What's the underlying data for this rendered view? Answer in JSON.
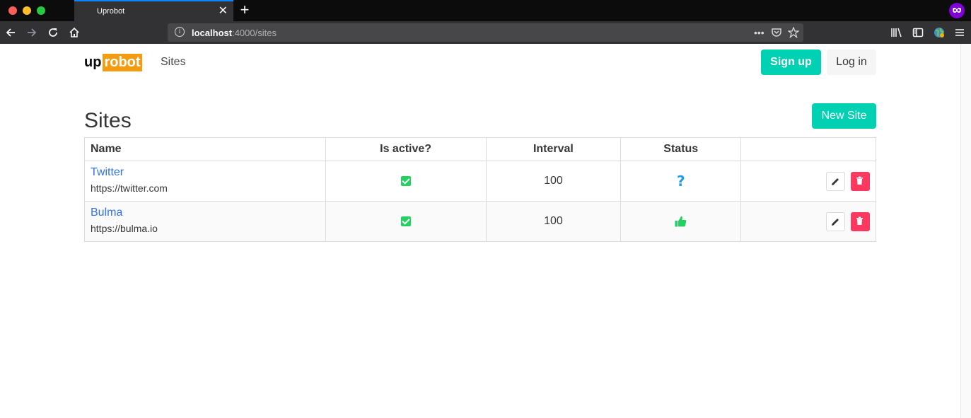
{
  "browser": {
    "tab_title": "Uprobot",
    "tab_close": "✕",
    "new_tab": "+",
    "url_host": "localhost",
    "url_path": ":4000/sites",
    "url_more": "•••"
  },
  "header": {
    "logo_up": "up",
    "logo_robot": "robot",
    "nav_sites": "Sites",
    "signup_label": "Sign up",
    "login_label": "Log in"
  },
  "main": {
    "title": "Sites",
    "new_site_label": "New Site",
    "columns": [
      "Name",
      "Is active?",
      "Interval",
      "Status",
      ""
    ],
    "rows": [
      {
        "name": "Twitter",
        "url": "https://twitter.com",
        "active": true,
        "interval": "100",
        "status": "unknown",
        "status_icon": "question-icon"
      },
      {
        "name": "Bulma",
        "url": "https://bulma.io",
        "active": true,
        "interval": "100",
        "status": "up",
        "status_icon": "thumbs-up-icon"
      }
    ]
  },
  "colors": {
    "primary": "#00d1b2",
    "danger": "#ff3860",
    "success": "#23d160",
    "info": "#209cee",
    "link": "#3273dc",
    "logo_accent": "#f39c12"
  }
}
